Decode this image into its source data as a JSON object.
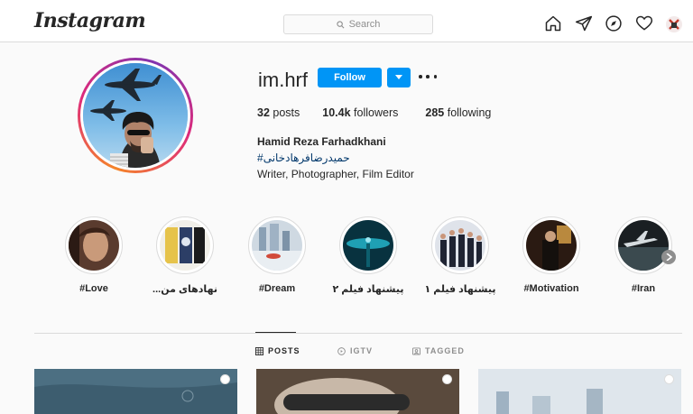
{
  "app": {
    "logo_text": "Instagram"
  },
  "search": {
    "placeholder": "Search"
  },
  "nav": {
    "icons": [
      "home-icon",
      "direct-icon",
      "explore-icon",
      "activity-icon",
      "profile-avatar"
    ]
  },
  "profile": {
    "username": "im.hrf",
    "follow_label": "Follow",
    "stats": {
      "posts_count": "32",
      "posts_label": "posts",
      "followers_count": "10.4k",
      "followers_label": "followers",
      "following_count": "285",
      "following_label": "following"
    },
    "full_name": "Hamid Reza Farhadkhani",
    "hashtag": "#حمیدرضافرهادخانی",
    "bio": "Writer, Photographer, Film Editor"
  },
  "highlights": [
    {
      "label": "#Love"
    },
    {
      "label": "...نهادهای من"
    },
    {
      "label": "#Dream"
    },
    {
      "label": "پیشنهاد فیلم ۲"
    },
    {
      "label": "پیشنهاد فیلم ۱"
    },
    {
      "label": "#Motivation"
    },
    {
      "label": "#Iran"
    }
  ],
  "tabs": [
    {
      "label": "POSTS",
      "icon": "grid-icon",
      "active": true
    },
    {
      "label": "IGTV",
      "icon": "igtv-icon",
      "active": false
    },
    {
      "label": "TAGGED",
      "icon": "tagged-icon",
      "active": false
    }
  ],
  "colors": {
    "accent": "#0095f6",
    "text": "#262626",
    "muted": "#8e8e8e",
    "border": "#dbdbdb",
    "link": "#00376b"
  }
}
